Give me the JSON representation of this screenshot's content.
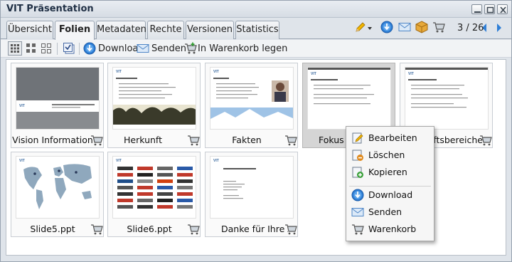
{
  "window": {
    "title": "VIT Präsentation"
  },
  "tabs": [
    {
      "label": "Übersicht",
      "active": false
    },
    {
      "label": "Folien",
      "active": true
    },
    {
      "label": "Metadaten",
      "active": false
    },
    {
      "label": "Rechte",
      "active": false
    },
    {
      "label": "Versionen",
      "active": false
    },
    {
      "label": "Statistics",
      "active": false
    }
  ],
  "pager": {
    "text": "3 / 26"
  },
  "toolbar": {
    "download_label": "Download",
    "send_label": "Senden",
    "cart_label": "In Warenkorb legen"
  },
  "slides": [
    {
      "caption": "Vision Information",
      "selected": false
    },
    {
      "caption": "Herkunft",
      "selected": false
    },
    {
      "caption": "Fakten",
      "selected": false
    },
    {
      "caption": "Fokus auf Lösungen",
      "selected": true
    },
    {
      "caption": "Geschäftsbereiche",
      "selected": false
    },
    {
      "caption": "Slide5.ppt",
      "selected": false
    },
    {
      "caption": "Slide6.ppt",
      "selected": false
    },
    {
      "caption": "Danke für Ihre Aufmerksamkeit",
      "selected": false
    }
  ],
  "context_menu": {
    "items": [
      "Bearbeiten",
      "Löschen",
      "Kopieren",
      "Download",
      "Senden",
      "Warenkorb"
    ]
  },
  "colors": {
    "accent_blue": "#2f7fd6",
    "tab_border": "#9aa5b2",
    "selection_gray": "#d5d5d5"
  }
}
